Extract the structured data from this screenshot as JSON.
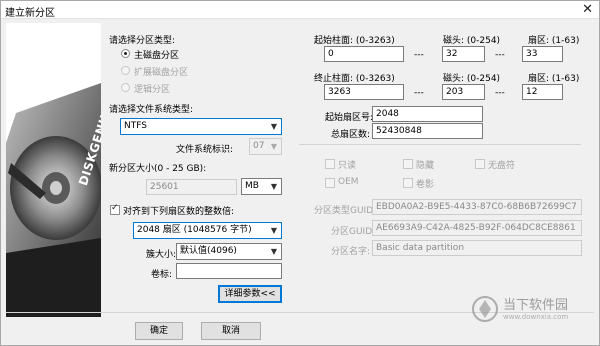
{
  "window": {
    "title": "建立新分区",
    "close_glyph": "✕"
  },
  "partition_type": {
    "label": "请选择分区类型:",
    "options": [
      {
        "label": "主磁盘分区",
        "selected": true,
        "enabled": true
      },
      {
        "label": "扩展磁盘分区",
        "selected": false,
        "enabled": false
      },
      {
        "label": "逻辑分区",
        "selected": false,
        "enabled": false
      }
    ]
  },
  "filesystem": {
    "label": "请选择文件系统类型:",
    "value": "NTFS",
    "id_label": "文件系统标识:",
    "id_value": "07"
  },
  "size": {
    "label": "新分区大小(0 - 25 GB):",
    "value": "25601",
    "unit": "MB"
  },
  "align": {
    "checkbox_label": "对齐到下列扇区数的整数倍:",
    "checked": true,
    "value": "2048 扇区 (1048576 字节)"
  },
  "cluster": {
    "label": "簇大小:",
    "value": "默认值(4096)"
  },
  "volume": {
    "label": "卷标:",
    "value": ""
  },
  "details_button": "详细参数<<",
  "ok_button": "确定",
  "cancel_button": "取消",
  "start_chs": {
    "cyl_label": "起始柱面: (0-3263)",
    "cyl": "0",
    "head_label": "磁头: (0-254)",
    "head": "32",
    "sector_label": "扇区: (1-63)",
    "sector": "33"
  },
  "end_chs": {
    "cyl_label": "终止柱面: (0-3263)",
    "cyl": "3263",
    "head_label": "磁头: (0-254)",
    "head": "203",
    "sector_label": "扇区: (1-63)",
    "sector": "12"
  },
  "dash": "---",
  "start_sector": {
    "label": "起始扇区号:",
    "value": "2048"
  },
  "total_sectors": {
    "label": "总扇区数:",
    "value": "52430848"
  },
  "flags": {
    "readonly": "只读",
    "hidden": "隐藏",
    "no_drive_letter": "无盘符",
    "oem": "OEM",
    "shadow": "卷影"
  },
  "guid": {
    "type_label": "分区类型GUID:",
    "type_value": "EBD0A0A2-B9E5-4433-87C0-68B6B72699C7",
    "id_label": "分区GUID:",
    "id_value": "AE6693A9-C42A-4825-B92F-064DC8CE8861",
    "name_label": "分区名字:",
    "name_value": "Basic data partition"
  },
  "logo_text": "DISKGENIUS",
  "watermark": {
    "text": "当下软件园",
    "url": "www.downxia.com"
  }
}
